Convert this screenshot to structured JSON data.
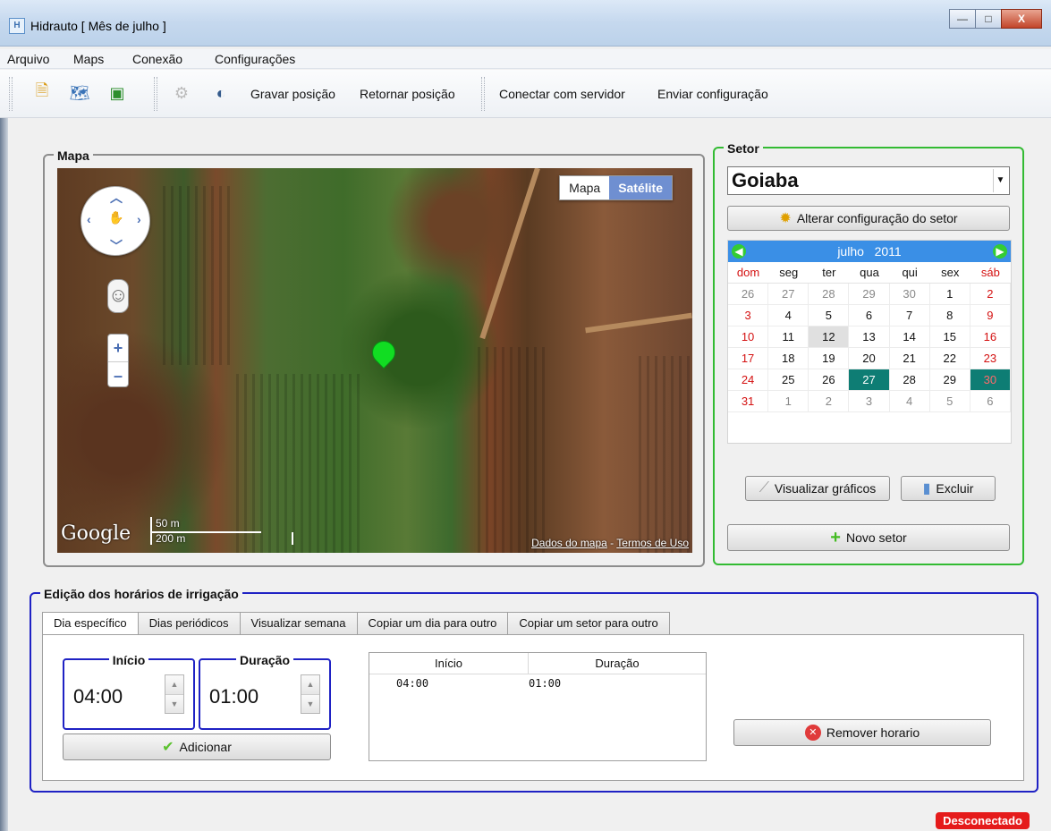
{
  "window": {
    "title": "Hidrauto [ Mês de julho ]",
    "minimize": "—",
    "maximize": "□",
    "close": "X"
  },
  "menu": {
    "items": [
      "Arquivo",
      "Maps",
      "Conexão",
      "Configurações"
    ]
  },
  "toolbar": {
    "gravar": "Gravar posição",
    "retornar": "Retornar posição",
    "conectar": "Conectar com servidor",
    "enviar": "Enviar configuração"
  },
  "map": {
    "group_title": "Mapa",
    "type_map": "Mapa",
    "type_satellite": "Satélite",
    "zoom_in": "+",
    "zoom_out": "–",
    "logo": "Google",
    "scale_m": "50 m",
    "scale_big": "200 m",
    "credits_data": "Dados do mapa",
    "credits_sep": " - ",
    "credits_terms": "Termos de Uso"
  },
  "setor": {
    "group_title": "Setor",
    "selected": "Goiaba",
    "alterar": "Alterar configuração do setor",
    "visualizar": "Visualizar gráficos",
    "excluir": "Excluir",
    "novo": "Novo setor"
  },
  "calendar": {
    "month": "julho",
    "year": "2011",
    "weekdays": [
      "dom",
      "seg",
      "ter",
      "qua",
      "qui",
      "sex",
      "sáb"
    ],
    "weeks": [
      [
        "26",
        "27",
        "28",
        "29",
        "30",
        "1",
        "2"
      ],
      [
        "3",
        "4",
        "5",
        "6",
        "7",
        "8",
        "9"
      ],
      [
        "10",
        "11",
        "12",
        "13",
        "14",
        "15",
        "16"
      ],
      [
        "17",
        "18",
        "19",
        "20",
        "21",
        "22",
        "23"
      ],
      [
        "24",
        "25",
        "26",
        "27",
        "28",
        "29",
        "30"
      ],
      [
        "31",
        "1",
        "2",
        "3",
        "4",
        "5",
        "6"
      ]
    ],
    "today": "12",
    "selected": [
      "27",
      "30"
    ]
  },
  "edit": {
    "group_title": "Edição dos horários de irrigação",
    "tabs": [
      "Dia específico",
      "Dias periódicos",
      "Visualizar semana",
      "Copiar um dia para outro",
      "Copiar um setor para outro"
    ],
    "inicio_label": "Início",
    "inicio_value": "04:00",
    "duracao_label": "Duração",
    "duracao_value": "01:00",
    "adicionar": "Adicionar",
    "table_headers": [
      "Início",
      "Duração"
    ],
    "table_rows": [
      [
        "04:00",
        "01:00"
      ]
    ],
    "remover": "Remover horario"
  },
  "status": {
    "text": "Desconectado"
  },
  "colors": {
    "setor_border": "#33bb33",
    "edit_border": "#1f22c4",
    "calendar_header": "#3a8fe6",
    "selected_day": "#0e7d74",
    "status_bg": "#e51b1b"
  }
}
